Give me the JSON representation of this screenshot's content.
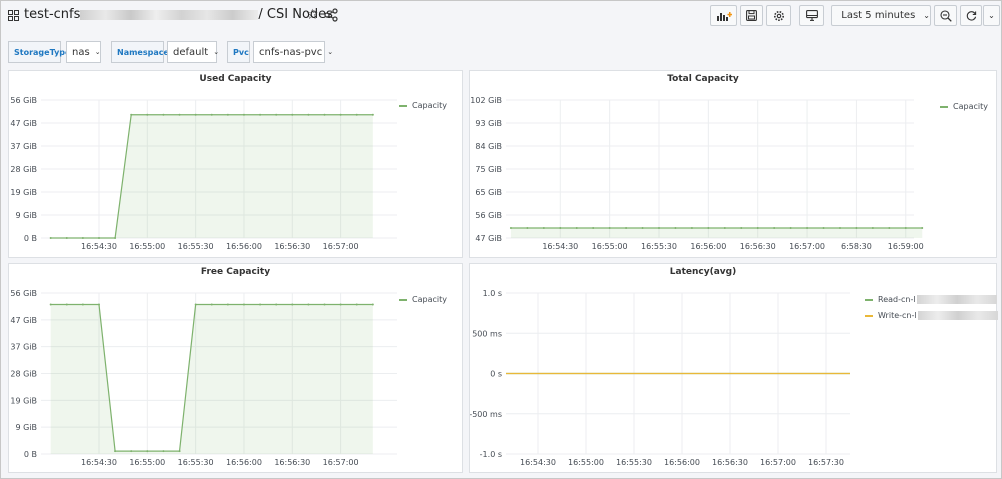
{
  "header": {
    "title_prefix": "test-cnfs",
    "title_suffix": "/ CSI Nodes",
    "time_range": "Last 5 minutes"
  },
  "icons": {
    "apps": "apps-icon",
    "star": "star-icon",
    "share": "share-icon",
    "add_panel": "add-panel-icon",
    "save": "save-icon",
    "settings": "gear-icon",
    "tv": "tv-mode-icon",
    "clock": "clock-icon",
    "zoom_out": "zoom-out-icon",
    "refresh": "refresh-icon"
  },
  "variables": [
    {
      "label": "StorageType",
      "value": "nas"
    },
    {
      "label": "Namespace",
      "value": "default"
    },
    {
      "label": "Pvc",
      "value": "cnfs-nas-pvc"
    }
  ],
  "colors": {
    "series_green": "#7eb26d",
    "series_yellow": "#eab839",
    "label_blue": "#1f78c1"
  },
  "chart_data": [
    {
      "type": "area",
      "title": "Used Capacity",
      "y_ticks": [
        "0 B",
        "9 GiB",
        "19 GiB",
        "28 GiB",
        "37 GiB",
        "47 GiB",
        "56 GiB"
      ],
      "x_ticks": [
        "16:54:30",
        "16:55:00",
        "16:55:30",
        "16:56:00",
        "16:56:30",
        "16:57:00"
      ],
      "ylim": [
        0,
        56
      ],
      "series": [
        {
          "name": "Capacity",
          "x": [
            "16:54:00",
            "16:54:10",
            "16:54:20",
            "16:54:30",
            "16:54:40",
            "16:54:50",
            "16:55:00",
            "16:55:10",
            "16:55:20",
            "16:55:30",
            "16:55:40",
            "16:55:50",
            "16:56:00",
            "16:56:10",
            "16:56:20",
            "16:56:30",
            "16:56:40",
            "16:56:50",
            "16:57:00",
            "16:57:10",
            "16:57:20"
          ],
          "values": [
            0,
            0,
            0,
            0,
            0,
            50,
            50,
            50,
            50,
            50,
            50,
            50,
            50,
            50,
            50,
            50,
            50,
            50,
            50,
            50,
            50
          ]
        }
      ]
    },
    {
      "type": "area",
      "title": "Total Capacity",
      "y_ticks": [
        "47 GiB",
        "56 GiB",
        "65 GiB",
        "75 GiB",
        "84 GiB",
        "93 GiB",
        "102 GiB"
      ],
      "x_ticks": [
        "16:54:30",
        "16:55:00",
        "16:55:30",
        "16:56:00",
        "16:56:30",
        "16:57:00",
        "6:58:30",
        "16:59:00"
      ],
      "ylim": [
        47,
        102
      ],
      "series": [
        {
          "name": "Capacity",
          "x": [
            "16:54:00",
            "16:54:10",
            "16:54:20",
            "16:54:30",
            "16:54:40",
            "16:54:50",
            "16:55:00",
            "16:55:10",
            "16:55:20",
            "16:55:30",
            "16:55:40",
            "16:55:50",
            "16:56:00",
            "16:56:10",
            "16:56:20",
            "16:56:30",
            "16:56:40",
            "16:56:50",
            "16:57:00",
            "16:57:10",
            "16:57:20",
            "16:57:30",
            "16:57:40",
            "16:57:50",
            "16:58:00",
            "16:58:10"
          ],
          "values": [
            51,
            51,
            51,
            51,
            51,
            51,
            51,
            51,
            51,
            51,
            51,
            51,
            51,
            51,
            51,
            51,
            51,
            51,
            51,
            51,
            51,
            51,
            51,
            51,
            51,
            51
          ]
        }
      ]
    },
    {
      "type": "area",
      "title": "Free Capacity",
      "y_ticks": [
        "0 B",
        "9 GiB",
        "19 GiB",
        "28 GiB",
        "37 GiB",
        "47 GiB",
        "56 GiB"
      ],
      "x_ticks": [
        "16:54:30",
        "16:55:00",
        "16:55:30",
        "16:56:00",
        "16:56:30",
        "16:57:00"
      ],
      "ylim": [
        0,
        56
      ],
      "series": [
        {
          "name": "Capacity",
          "x": [
            "16:54:00",
            "16:54:10",
            "16:54:20",
            "16:54:30",
            "16:54:40",
            "16:54:50",
            "16:55:00",
            "16:55:10",
            "16:55:20",
            "16:55:30",
            "16:55:40",
            "16:55:50",
            "16:56:00",
            "16:56:10",
            "16:56:20",
            "16:56:30",
            "16:56:40",
            "16:56:50",
            "16:57:00",
            "16:57:10",
            "16:57:20"
          ],
          "values": [
            52,
            52,
            52,
            52,
            1,
            1,
            1,
            1,
            1,
            52,
            52,
            52,
            52,
            52,
            52,
            52,
            52,
            52,
            52,
            52,
            52
          ]
        }
      ]
    },
    {
      "type": "line",
      "title": "Latency(avg)",
      "y_ticks": [
        "-1.0 s",
        "-500 ms",
        "0 s",
        "500 ms",
        "1.0 s"
      ],
      "x_ticks": [
        "16:54:30",
        "16:55:00",
        "16:55:30",
        "16:56:00",
        "16:56:30",
        "16:57:00",
        "16:57:30"
      ],
      "ylim": [
        -1,
        1
      ],
      "series": [
        {
          "name": "Read-cn-l",
          "values": [
            0,
            0
          ]
        },
        {
          "name": "Write-cn-l",
          "values": [
            0,
            0
          ]
        }
      ]
    }
  ]
}
